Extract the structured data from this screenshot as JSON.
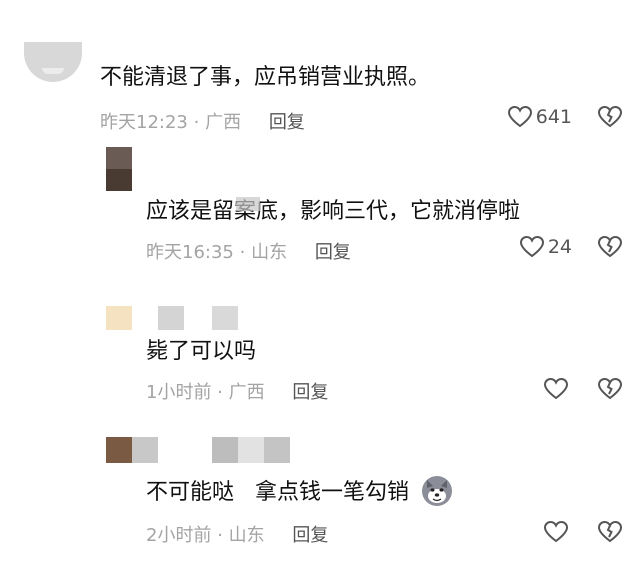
{
  "comments": [
    {
      "text": "不能清退了事，应吊销营业执照。",
      "time": "昨天12:23",
      "location": "广西",
      "reply": "回复",
      "likes": "641"
    },
    {
      "text": "应该是留案底，影响三代，它就消停啦",
      "time": "昨天16:35",
      "location": "山东",
      "reply": "回复",
      "likes": "24"
    },
    {
      "text": "毙了可以吗",
      "time": "1小时前",
      "location": "广西",
      "reply": "回复",
      "likes": ""
    },
    {
      "text": "不可能哒   拿点钱一笔勾销",
      "time": "2小时前",
      "location": "山东",
      "reply": "回复",
      "likes": ""
    }
  ],
  "separator": "·",
  "icons": {
    "like": "heart-outline-icon",
    "dislike": "broken-heart-icon",
    "emoji": "dog-face-emoji"
  }
}
